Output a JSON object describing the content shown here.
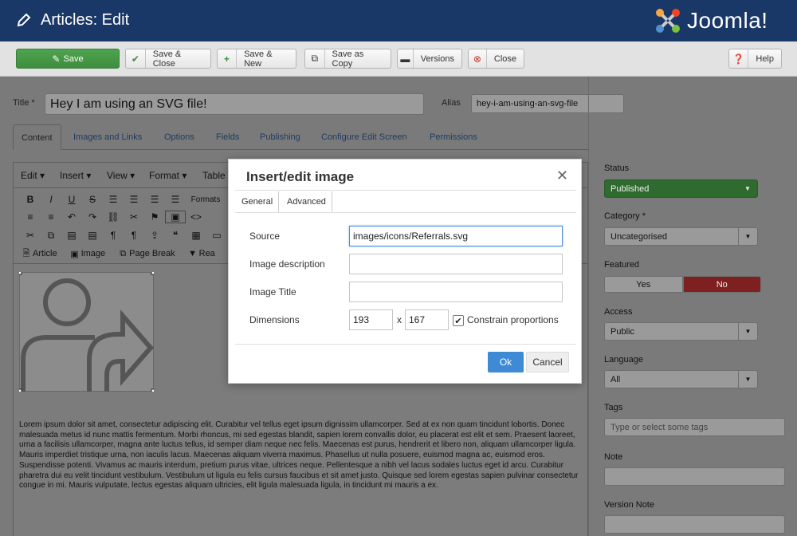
{
  "header": {
    "title": "Articles: Edit",
    "logo_text": "Joomla!"
  },
  "toolbar": {
    "save": "Save",
    "save_close": "Save & Close",
    "save_new": "Save & New",
    "save_copy": "Save as Copy",
    "versions": "Versions",
    "close": "Close",
    "help": "Help"
  },
  "form": {
    "title_label": "Title *",
    "title_value": "Hey I am using an SVG file!",
    "alias_label": "Alias",
    "alias_value": "hey-i-am-using-an-svg-file"
  },
  "tabs": [
    "Content",
    "Images and Links",
    "Options",
    "Fields",
    "Publishing",
    "Configure Edit Screen",
    "Permissions"
  ],
  "editor": {
    "menus": [
      "Edit",
      "Insert",
      "View",
      "Format",
      "Table"
    ],
    "formats_label": "Formats",
    "buttons": {
      "article": "Article",
      "image": "Image",
      "page_break": "Page Break",
      "read_more": "Rea"
    },
    "lorem": "Lorem ipsum dolor sit amet, consectetur adipiscing elit. Curabitur vel tellus eget ipsum dignissim ullamcorper. Sed at ex non quam tincidunt lobortis. Donec malesuada metus id nunc mattis fermentum. Morbi rhoncus, mi sed egestas blandit, sapien lorem convallis dolor, eu placerat est elit et sem. Praesent laoreet, urna a facilisis ullamcorper, magna ante luctus tellus, id semper diam neque nec felis. Maecenas est purus, hendrerit et libero non, aliquam ullamcorper ligula. Mauris imperdiet tristique urna, non iaculis lacus. Maecenas aliquam viverra maximus. Phasellus ut nulla posuere, euismod magna ac, euismod eros. Suspendisse potenti. Vivamus ac mauris interdum, pretium purus vitae, ultrices neque. Pellentesque a nibh vel lacus sodales luctus eget id arcu. Curabitur pharetra dui eu velit tincidunt vestibulum. Vestibulum ut ligula eu felis cursus faucibus et sit amet justo. Quisque sed lorem egestas sapien pulvinar consectetur congue in mi. Mauris vulputate, lectus egestas aliquam ultricies, elit ligula malesuada ligula, in tincidunt mi mauris a ex."
  },
  "sidebar": {
    "status_label": "Status",
    "status_value": "Published",
    "category_label": "Category *",
    "category_value": "Uncategorised",
    "featured_label": "Featured",
    "yes": "Yes",
    "no": "No",
    "access_label": "Access",
    "access_value": "Public",
    "language_label": "Language",
    "language_value": "All",
    "tags_label": "Tags",
    "tags_placeholder": "Type or select some tags",
    "note_label": "Note",
    "version_note_label": "Version Note"
  },
  "modal": {
    "title": "Insert/edit image",
    "tab_general": "General",
    "tab_advanced": "Advanced",
    "source_label": "Source",
    "source_value": "images/icons/Referrals.svg",
    "desc_label": "Image description",
    "title_label": "Image Title",
    "dims_label": "Dimensions",
    "width": "193",
    "x": "x",
    "height": "167",
    "constrain_label": "Constrain proportions",
    "ok": "Ok",
    "cancel": "Cancel"
  },
  "colors": {
    "header": "#1a3867",
    "save": "#46a046",
    "ok": "#3e8ad4",
    "no": "#bd362f"
  }
}
